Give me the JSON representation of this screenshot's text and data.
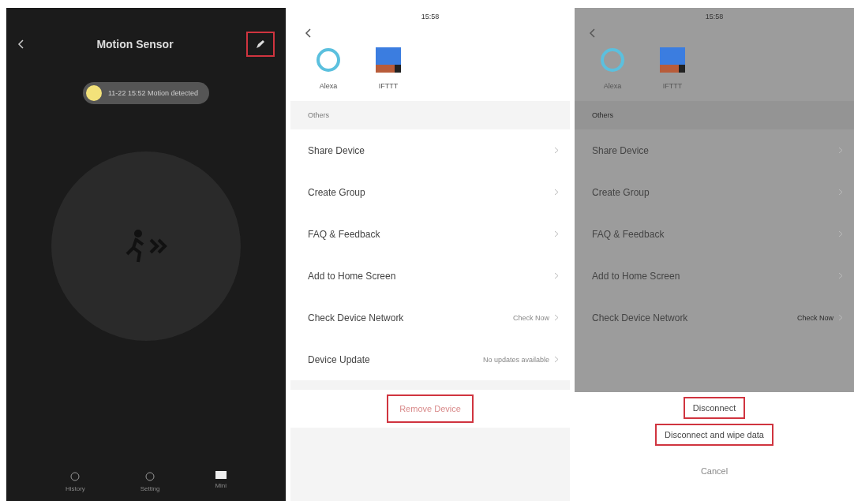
{
  "device_screen": {
    "title": "Motion Sensor",
    "edit_highlighted": true,
    "status": "11-22 15:52 Motion detected",
    "tabs": [
      {
        "label": "History"
      },
      {
        "label": "Setting"
      },
      {
        "label": "Mini"
      }
    ]
  },
  "settings_screen": {
    "time": "15:58",
    "integrations": [
      {
        "kind": "alexa",
        "label": "Alexa"
      },
      {
        "kind": "ifttt",
        "label": "IFTTT"
      }
    ],
    "section": "Others",
    "items": [
      {
        "label": "Share Device"
      },
      {
        "label": "Create Group"
      },
      {
        "label": "FAQ & Feedback"
      },
      {
        "label": "Add to Home Screen"
      },
      {
        "label": "Check Device Network",
        "value": "Check Now"
      },
      {
        "label": "Device Update",
        "value": "No updates available"
      }
    ],
    "remove_button": {
      "label": "Remove Device",
      "highlighted": true
    }
  },
  "action_screen": {
    "time": "15:58",
    "integrations": [
      {
        "kind": "alexa",
        "label": "Alexa"
      },
      {
        "kind": "ifttt",
        "label": "IFTTT"
      }
    ],
    "section": "Others",
    "items": [
      {
        "label": "Share Device"
      },
      {
        "label": "Create Group"
      },
      {
        "label": "FAQ & Feedback"
      },
      {
        "label": "Add to Home Screen"
      },
      {
        "label": "Check Device Network",
        "value": "Check Now"
      }
    ],
    "sheet": [
      {
        "kind": "action",
        "label": "Disconnect",
        "highlighted": true
      },
      {
        "kind": "action",
        "label": "Disconnect and wipe data",
        "highlighted": true
      },
      {
        "kind": "cancel",
        "label": "Cancel",
        "highlighted": false
      }
    ]
  }
}
